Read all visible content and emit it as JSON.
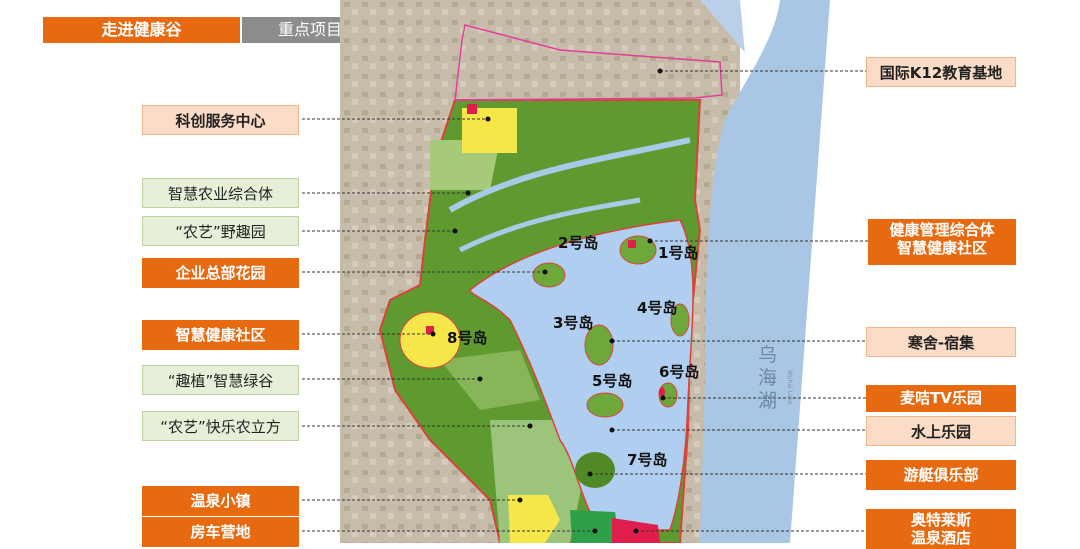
{
  "header": {
    "tab_active": "走进健康谷",
    "tab_inactive": "重点项目布局"
  },
  "labels": {
    "k12": "国际K12教育基地",
    "kechuang": "科创服务中心",
    "nongye": "智慧农业综合体",
    "nongyi_yequ": "“农艺”野趣园",
    "qiye": "企业总部花园",
    "shequ_left": "智慧健康社区",
    "quzhi": "“趣植”智慧绿谷",
    "nongyi_kuaile": "“农艺”快乐农立方",
    "wenquan_town": "温泉小镇",
    "fangche": "房车营地",
    "jiankang_line1": "健康管理综合体",
    "jiankang_line2": "智慧健康社区",
    "hanshe": "寒舍-宿集",
    "maigu": "麦咭TV乐园",
    "shuishang": "水上乐园",
    "youting": "游艇俱乐部",
    "aotelaisi_line1": "奥特莱斯",
    "aotelaisi_line2": "温泉酒店"
  },
  "map": {
    "islands": [
      "1号岛",
      "2号岛",
      "3号岛",
      "4号岛",
      "5号岛",
      "6号岛",
      "7号岛",
      "8号岛"
    ],
    "lake_name_chars": [
      "乌",
      "海",
      "湖"
    ],
    "lake_name_en": "Wuhai Lake"
  },
  "colors": {
    "accent_orange": "#e86a10",
    "tab_gray": "#8c8c8c",
    "lake_blue": "#b7d4ef",
    "park_green": "#5e9a30",
    "boundary_pink": "#e0409a"
  }
}
